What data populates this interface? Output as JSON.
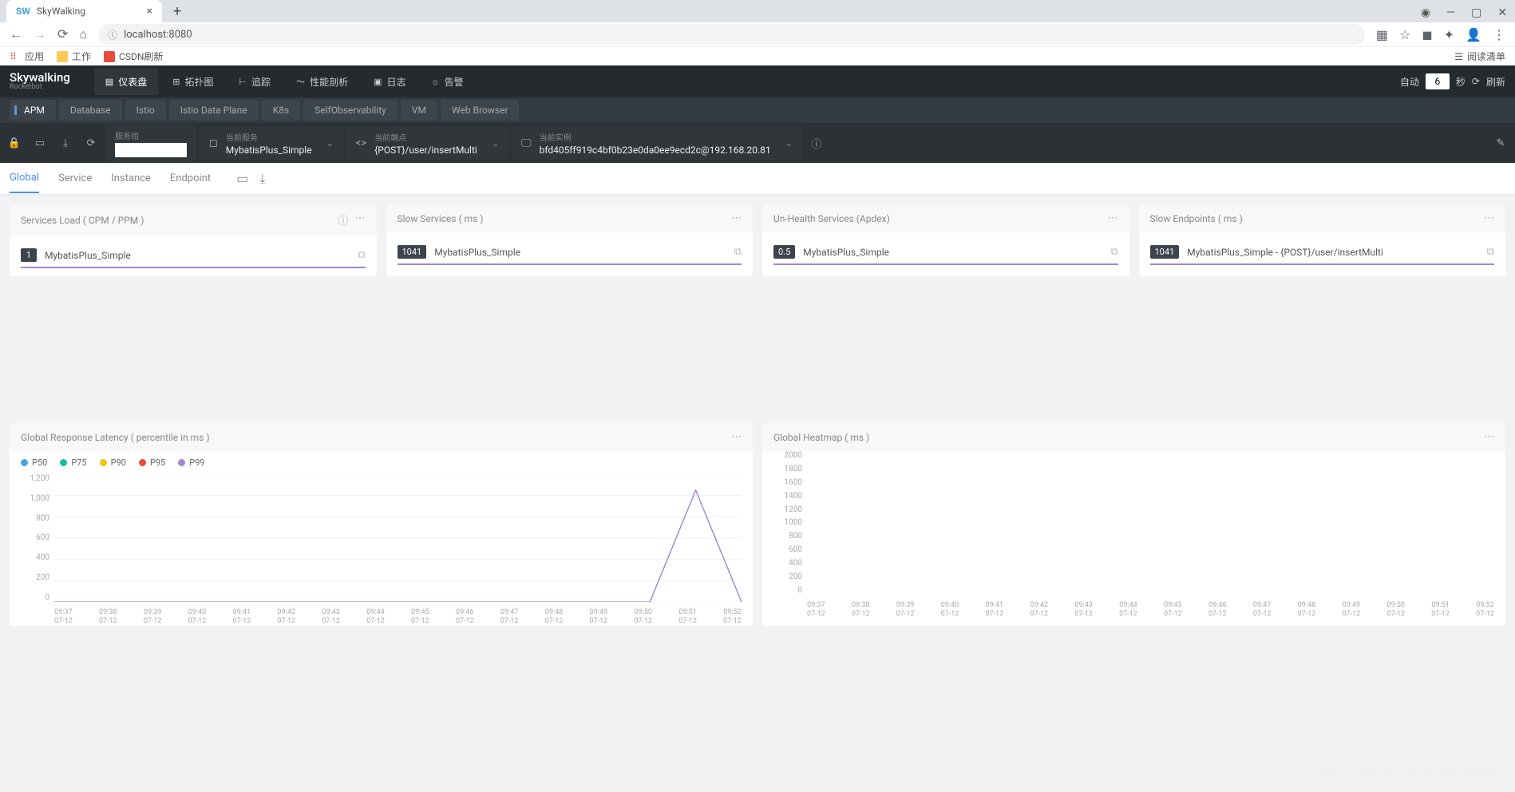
{
  "browser": {
    "tab_title": "SkyWalking",
    "url": "localhost:8080",
    "bookmarks": {
      "apps": "应用",
      "work": "工作",
      "csdn": "CSDN刷新",
      "reading": "阅读清单"
    }
  },
  "header": {
    "logo_main": "Skywalking",
    "logo_sub": "Rocketbot",
    "nav": [
      "仪表盘",
      "拓扑图",
      "追踪",
      "性能剖析",
      "日志",
      "告警"
    ],
    "auto_label": "自动",
    "refresh_value": "6",
    "refresh_unit": "秒",
    "refresh_action": "刷新"
  },
  "subnav": [
    "APM",
    "Database",
    "Istio",
    "Istio Data Plane",
    "K8s",
    "SelfObservability",
    "VM",
    "Web Browser"
  ],
  "selectors": {
    "group": {
      "label": "服务组",
      "value": ""
    },
    "service": {
      "label": "当前服务",
      "value": "MybatisPlus_Simple"
    },
    "endpoint": {
      "label": "当前端点",
      "value": "{POST}/user/insertMulti"
    },
    "instance": {
      "label": "当前实例",
      "value": "bfd405ff919c4bf0b23e0da0ee9ecd2c@192.168.20.81"
    }
  },
  "scope_tabs": [
    "Global",
    "Service",
    "Instance",
    "Endpoint"
  ],
  "cards": {
    "services_load": {
      "title": "Services Load ( CPM / PPM )",
      "badge": "1",
      "text": "MybatisPlus_Simple"
    },
    "slow_services": {
      "title": "Slow Services ( ms )",
      "badge": "1041",
      "text": "MybatisPlus_Simple"
    },
    "unhealth": {
      "title": "Un-Health Services (Apdex)",
      "badge": "0.5",
      "text": "MybatisPlus_Simple"
    },
    "slow_endpoints": {
      "title": "Slow Endpoints ( ms )",
      "badge": "1041",
      "text": "MybatisPlus_Simple - {POST}/user/insertMulti"
    }
  },
  "chart_data": [
    {
      "type": "line",
      "title": "Global Response Latency ( percentile in ms )",
      "series": [
        {
          "name": "P50",
          "color": "#4aa3df",
          "values": [
            0,
            0,
            0,
            0,
            0,
            0,
            0,
            0,
            0,
            0,
            0,
            0,
            0,
            0,
            1050,
            0
          ]
        },
        {
          "name": "P75",
          "color": "#1abc9c",
          "values": [
            0,
            0,
            0,
            0,
            0,
            0,
            0,
            0,
            0,
            0,
            0,
            0,
            0,
            0,
            1050,
            0
          ]
        },
        {
          "name": "P90",
          "color": "#f1c40f",
          "values": [
            0,
            0,
            0,
            0,
            0,
            0,
            0,
            0,
            0,
            0,
            0,
            0,
            0,
            0,
            1050,
            0
          ]
        },
        {
          "name": "P95",
          "color": "#e74c3c",
          "values": [
            0,
            0,
            0,
            0,
            0,
            0,
            0,
            0,
            0,
            0,
            0,
            0,
            0,
            0,
            1050,
            0
          ]
        },
        {
          "name": "P99",
          "color": "#a487d4",
          "values": [
            0,
            0,
            0,
            0,
            0,
            0,
            0,
            0,
            0,
            0,
            0,
            0,
            0,
            0,
            1050,
            0
          ]
        }
      ],
      "x": [
        "09:37",
        "09:38",
        "09:39",
        "09:40",
        "09:41",
        "09:42",
        "09:43",
        "09:44",
        "09:45",
        "09:46",
        "09:47",
        "09:48",
        "09:49",
        "09:50",
        "09:51",
        "09:52"
      ],
      "x_sub": "07-12",
      "ylim": [
        0,
        1200
      ],
      "yticks": [
        0,
        200,
        400,
        600,
        800,
        1000,
        1200
      ]
    },
    {
      "type": "heatmap",
      "title": "Global Heatmap ( ms )",
      "x": [
        "09:37",
        "09:38",
        "09:39",
        "09:40",
        "09:41",
        "09:42",
        "09:43",
        "09:44",
        "09:45",
        "09:46",
        "09:47",
        "09:48",
        "09:49",
        "09:50",
        "09:51",
        "09:52"
      ],
      "x_sub": "07-12",
      "yticks": [
        0,
        200,
        400,
        600,
        800,
        1000,
        1200,
        1400,
        1600,
        1800,
        2000
      ]
    }
  ],
  "watermark": "https://blog.csdn.net/feiying0canglang"
}
